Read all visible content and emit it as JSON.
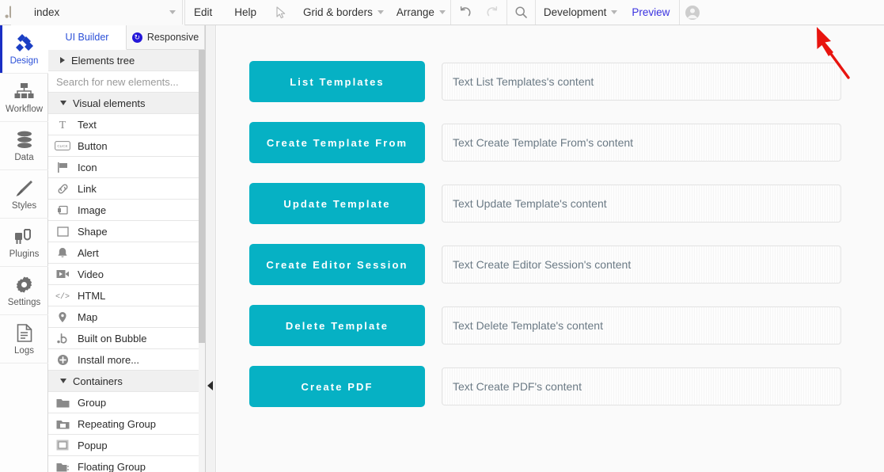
{
  "topbar": {
    "logo_icon": "bubble-logo-icon",
    "page_select": {
      "label": "Page: index",
      "caret_icon": "chevron-down-icon"
    },
    "element_select": {
      "label": "index",
      "caret_icon": "chevron-down-icon"
    },
    "edit_label": "Edit",
    "help_label": "Help",
    "pointer_icon": "cursor-pointer-icon",
    "grid_borders": {
      "label": "Grid & borders",
      "caret_icon": "chevron-down-icon"
    },
    "arrange": {
      "label": "Arrange",
      "caret_icon": "chevron-down-icon"
    },
    "undo_icon": "undo-icon",
    "redo_icon": "redo-icon",
    "search_icon": "search-icon",
    "version": {
      "label": "Development",
      "caret_icon": "chevron-down-icon"
    },
    "preview_label": "Preview",
    "preview_color": "#3a32e0",
    "avatar_icon": "user-avatar-icon"
  },
  "rail": {
    "items": [
      {
        "label": "Design",
        "icon": "design-icon",
        "active": true
      },
      {
        "label": "Workflow",
        "icon": "workflow-icon",
        "active": false
      },
      {
        "label": "Data",
        "icon": "data-icon",
        "active": false
      },
      {
        "label": "Styles",
        "icon": "styles-icon",
        "active": false
      },
      {
        "label": "Plugins",
        "icon": "plugins-icon",
        "active": false
      },
      {
        "label": "Settings",
        "icon": "settings-icon",
        "active": false
      },
      {
        "label": "Logs",
        "icon": "logs-icon",
        "active": false
      }
    ]
  },
  "panel": {
    "tabs": [
      {
        "label": "UI Builder",
        "active": true
      },
      {
        "label": "Responsive",
        "active": false,
        "icon": "responsive-icon"
      }
    ],
    "elements_tree_label": "Elements tree",
    "search_placeholder": "Search for new elements...",
    "sections": [
      {
        "title": "Visual elements",
        "expanded": true,
        "items": [
          {
            "label": "Text",
            "icon": "text-icon"
          },
          {
            "label": "Button",
            "icon": "button-icon"
          },
          {
            "label": "Icon",
            "icon": "flag-icon"
          },
          {
            "label": "Link",
            "icon": "link-icon"
          },
          {
            "label": "Image",
            "icon": "image-icon"
          },
          {
            "label": "Shape",
            "icon": "shape-icon"
          },
          {
            "label": "Alert",
            "icon": "alert-bell-icon"
          },
          {
            "label": "Video",
            "icon": "video-icon"
          },
          {
            "label": "HTML",
            "icon": "html-code-icon"
          },
          {
            "label": "Map",
            "icon": "map-pin-icon"
          },
          {
            "label": "Built on Bubble",
            "icon": "bubble-logo-icon"
          },
          {
            "label": "Install more...",
            "icon": "plus-circle-icon"
          }
        ]
      },
      {
        "title": "Containers",
        "expanded": true,
        "items": [
          {
            "label": "Group",
            "icon": "folder-icon"
          },
          {
            "label": "Repeating Group",
            "icon": "repeating-folder-icon"
          },
          {
            "label": "Popup",
            "icon": "popup-icon"
          },
          {
            "label": "Floating Group",
            "icon": "floating-folder-icon"
          }
        ]
      }
    ]
  },
  "canvas": {
    "accent_color": "#06b1c4",
    "collapse_handle_icon": "collapse-left-icon",
    "rows": [
      {
        "button_label": "List Templates",
        "text_label": "Text List Templates's content"
      },
      {
        "button_label": "Create Template From",
        "text_label": "Text Create Template From's content"
      },
      {
        "button_label": "Update Template",
        "text_label": "Text Update Template's content"
      },
      {
        "button_label": "Create Editor Session",
        "text_label": "Text Create Editor Session's content"
      },
      {
        "button_label": "Delete Template",
        "text_label": "Text Delete Template's content"
      },
      {
        "button_label": "Create PDF",
        "text_label": "Text Create PDF's content"
      }
    ]
  },
  "annotation": {
    "arrow_icon": "red-arrow-icon",
    "color": "#e8140f"
  }
}
